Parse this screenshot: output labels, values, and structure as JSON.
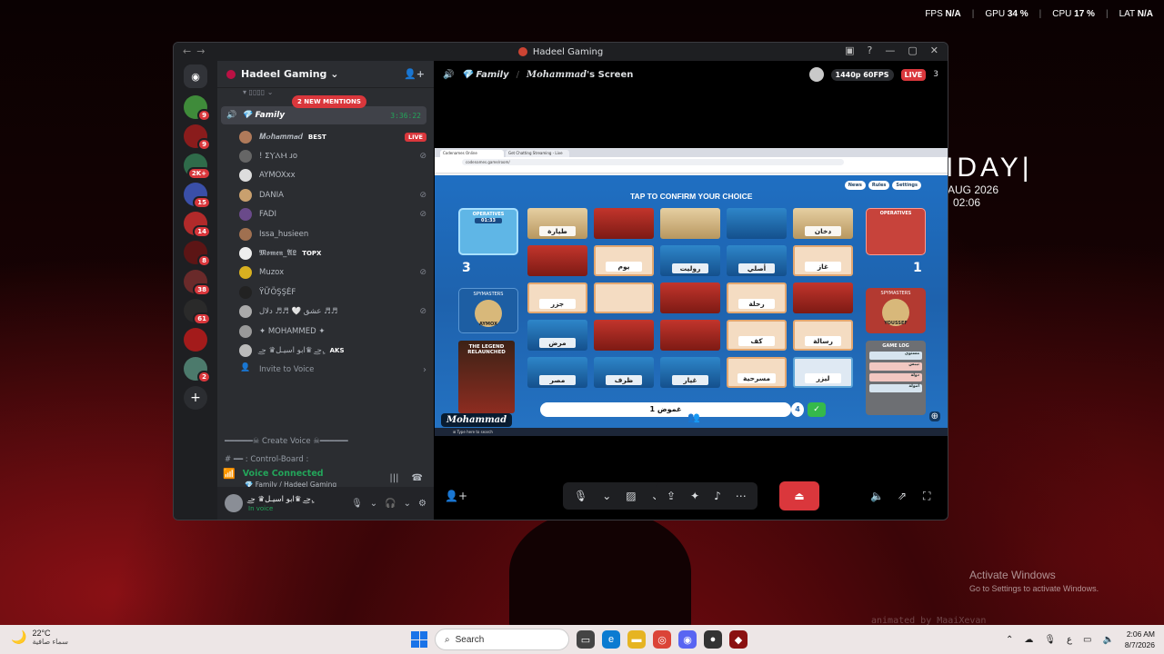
{
  "perf": {
    "fps_label": "FPS",
    "fps_value": "N/A",
    "gpu_label": "GPU",
    "gpu_value": "34 %",
    "cpu_label": "CPU",
    "cpu_value": "17 %",
    "lat_label": "LAT",
    "lat_value": "N/A"
  },
  "widget": {
    "day": "IDAY|",
    "date": "AUG 2026",
    "time": "02:06"
  },
  "activate": {
    "title": "Activate Windows",
    "subtitle": "Go to Settings to activate Windows."
  },
  "watermark": "animated by MaaiXevan",
  "window": {
    "title": "Hadeel Gaming"
  },
  "servers": [
    {
      "badge": "9",
      "color": "#3f8b3a"
    },
    {
      "badge": "9",
      "color": "#8a1c1c"
    },
    {
      "badge": "2K+",
      "color": "#2f6b4a"
    },
    {
      "badge": "15",
      "color": "#3a4fa8"
    },
    {
      "badge": "14",
      "color": "#b12a2a"
    },
    {
      "badge": "8",
      "color": "#5c1515"
    },
    {
      "badge": "38",
      "color": "#6a2a2a"
    },
    {
      "badge": "61",
      "color": "#2a2a2a"
    },
    {
      "badge": "",
      "color": "#a31b1b"
    },
    {
      "badge": "2",
      "color": "#4c7a6c"
    }
  ],
  "sidebar": {
    "guild_name": "Hadeel Gaming",
    "mentions": "2 NEW MENTIONS",
    "voice_channel": {
      "name": "💎 Family",
      "timer": "3:36:22"
    },
    "members": [
      {
        "name": "𝑴𝒐𝒉𝒂𝒎𝒎𝒂𝒅",
        "tag": "BEST",
        "live": "LIVE",
        "color": "#b07a5a"
      },
      {
        "name": "! ⵉⲨⲀⲘ ɹo",
        "tag": "",
        "muted": true,
        "color": "#666"
      },
      {
        "name": "AYMOXxx",
        "tag": "",
        "muted": false,
        "color": "#ddd"
      },
      {
        "name": "DANIA",
        "tag": "",
        "muted": true,
        "color": "#c9a06e"
      },
      {
        "name": "FADI",
        "tag": "",
        "muted": true,
        "color": "#6a4a8a"
      },
      {
        "name": "Issa_husieen",
        "tag": "",
        "muted": false,
        "color": "#a07050"
      },
      {
        "name": "𝕸𝖔𝖒𝖊𝖓_𝕬𝕷",
        "tag": "TOPX",
        "muted": false,
        "color": "#eee"
      },
      {
        "name": "Muzox",
        "tag": "",
        "muted": true,
        "color": "#d8b020"
      },
      {
        "name": "ΫỮÖŞŞĖF",
        "tag": "",
        "muted": false,
        "color": "#222"
      },
      {
        "name": "عشق 🤍 ♬♬ دلال ♬♬",
        "tag": "",
        "muted": true,
        "color": "#aaa"
      },
      {
        "name": "✦ MOHAMMED ✦",
        "tag": "",
        "muted": false,
        "color": "#999"
      },
      {
        "name": "ح͜ـ ♛ابو اسيـل♛ ح͜ـ.ِِ",
        "tag": "AKS",
        "muted": false,
        "color": "#bbb"
      }
    ],
    "invite": "Invite to Voice",
    "create_voice": "━━━━━━☠ Create Voice ☠━━━━━━",
    "control_board": "# ━━ : Control-Board :",
    "voice_panel": {
      "status": "Voice Connected",
      "channel": "💎 Family / Hadeel Gaming"
    },
    "user": {
      "name": "ح͜ـ ♛ابو اسيـل♛ ح͜ـ.ِِ",
      "status": "In voice"
    }
  },
  "stream": {
    "channel": "💎 Family",
    "screen_title_user": "𝑴𝒐𝒉𝒂𝒎𝒎𝒂𝒅",
    "screen_title_suffix": "'s Screen",
    "quality": "1440p 60FPS",
    "live": "LIVE",
    "viewers": "3",
    "streamer_tag": "𝑴𝒐𝒉𝒂𝒎𝒎𝒂𝒅"
  },
  "game": {
    "tap_text": "TAP   TO CONFIRM YOUR CHOICE",
    "top_buttons": [
      "News",
      "Rules",
      "Settings"
    ],
    "blue_ops_label": "OPERATIVES",
    "blue_timer": "01:33",
    "blue_score": "3",
    "blue_spy_label": "SPYMASTERS",
    "blue_spy_name": "AYMOX",
    "legend_text": "THE LEGEND RELAUNCHED",
    "red_ops_label": "OPERATIVES",
    "red_score": "1",
    "red_spy_label": "SPYMASTERS",
    "red_spy_name": "YOUSSEF",
    "gamelog_label": "GAME LOG",
    "gamelog_rows": [
      "مستوى",
      "نيبس",
      "دولة",
      "امولة"
    ],
    "clue": "غموض 1",
    "clue_number": "4",
    "cards": [
      {
        "word": "طيارة",
        "type": "bystander"
      },
      {
        "word": "",
        "type": "red"
      },
      {
        "word": "",
        "type": "bystander"
      },
      {
        "word": "",
        "type": "blue"
      },
      {
        "word": "دخان",
        "type": "bystander"
      },
      {
        "word": "",
        "type": "red"
      },
      {
        "word": "يوم",
        "type": "word-red"
      },
      {
        "word": "روليت",
        "type": "blue"
      },
      {
        "word": "أصلي",
        "type": "blue"
      },
      {
        "word": "غاز",
        "type": "word-red"
      },
      {
        "word": "جزر",
        "type": "word-red"
      },
      {
        "word": "",
        "type": "word-red"
      },
      {
        "word": "",
        "type": "red"
      },
      {
        "word": "رحلة",
        "type": "word-red"
      },
      {
        "word": "",
        "type": "red"
      },
      {
        "word": "مرض",
        "type": "blue"
      },
      {
        "word": "",
        "type": "red"
      },
      {
        "word": "",
        "type": "red"
      },
      {
        "word": "كف",
        "type": "word-red"
      },
      {
        "word": "رسالة",
        "type": "word-red"
      },
      {
        "word": "مصر",
        "type": "blue"
      },
      {
        "word": "ظرف",
        "type": "blue"
      },
      {
        "word": "غيار",
        "type": "blue"
      },
      {
        "word": "مسرحية",
        "type": "word-red"
      },
      {
        "word": "ليزر",
        "type": "word-blue"
      }
    ],
    "browser_tabs": [
      "Codenames Online",
      "Get Chatting Streaming - Live"
    ],
    "url": "codenames.game/room/"
  },
  "taskbar": {
    "temp": "22°C",
    "condition": "سماء صافية",
    "search": "Search",
    "lang": "ع",
    "time": "2:06 AM",
    "date": "8/7/2026"
  }
}
